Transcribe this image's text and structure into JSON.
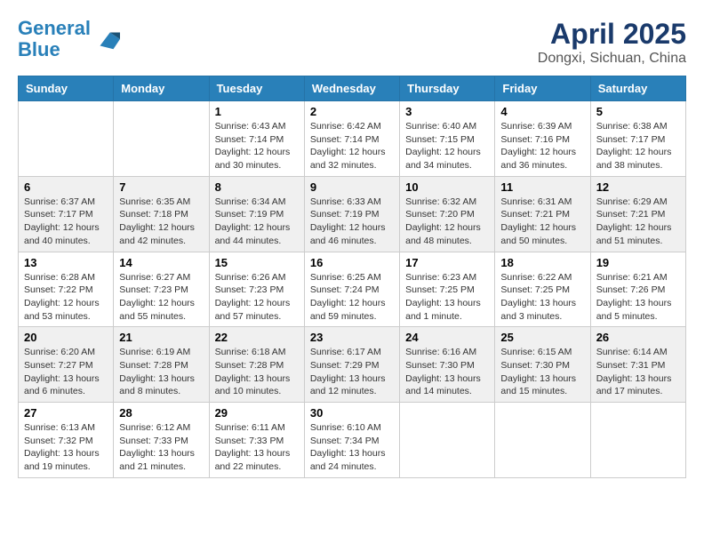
{
  "logo": {
    "line1": "General",
    "line2": "Blue"
  },
  "title": "April 2025",
  "location": "Dongxi, Sichuan, China",
  "headers": [
    "Sunday",
    "Monday",
    "Tuesday",
    "Wednesday",
    "Thursday",
    "Friday",
    "Saturday"
  ],
  "weeks": [
    [
      {
        "day": "",
        "info": ""
      },
      {
        "day": "",
        "info": ""
      },
      {
        "day": "1",
        "info": "Sunrise: 6:43 AM\nSunset: 7:14 PM\nDaylight: 12 hours and 30 minutes."
      },
      {
        "day": "2",
        "info": "Sunrise: 6:42 AM\nSunset: 7:14 PM\nDaylight: 12 hours and 32 minutes."
      },
      {
        "day": "3",
        "info": "Sunrise: 6:40 AM\nSunset: 7:15 PM\nDaylight: 12 hours and 34 minutes."
      },
      {
        "day": "4",
        "info": "Sunrise: 6:39 AM\nSunset: 7:16 PM\nDaylight: 12 hours and 36 minutes."
      },
      {
        "day": "5",
        "info": "Sunrise: 6:38 AM\nSunset: 7:17 PM\nDaylight: 12 hours and 38 minutes."
      }
    ],
    [
      {
        "day": "6",
        "info": "Sunrise: 6:37 AM\nSunset: 7:17 PM\nDaylight: 12 hours and 40 minutes."
      },
      {
        "day": "7",
        "info": "Sunrise: 6:35 AM\nSunset: 7:18 PM\nDaylight: 12 hours and 42 minutes."
      },
      {
        "day": "8",
        "info": "Sunrise: 6:34 AM\nSunset: 7:19 PM\nDaylight: 12 hours and 44 minutes."
      },
      {
        "day": "9",
        "info": "Sunrise: 6:33 AM\nSunset: 7:19 PM\nDaylight: 12 hours and 46 minutes."
      },
      {
        "day": "10",
        "info": "Sunrise: 6:32 AM\nSunset: 7:20 PM\nDaylight: 12 hours and 48 minutes."
      },
      {
        "day": "11",
        "info": "Sunrise: 6:31 AM\nSunset: 7:21 PM\nDaylight: 12 hours and 50 minutes."
      },
      {
        "day": "12",
        "info": "Sunrise: 6:29 AM\nSunset: 7:21 PM\nDaylight: 12 hours and 51 minutes."
      }
    ],
    [
      {
        "day": "13",
        "info": "Sunrise: 6:28 AM\nSunset: 7:22 PM\nDaylight: 12 hours and 53 minutes."
      },
      {
        "day": "14",
        "info": "Sunrise: 6:27 AM\nSunset: 7:23 PM\nDaylight: 12 hours and 55 minutes."
      },
      {
        "day": "15",
        "info": "Sunrise: 6:26 AM\nSunset: 7:23 PM\nDaylight: 12 hours and 57 minutes."
      },
      {
        "day": "16",
        "info": "Sunrise: 6:25 AM\nSunset: 7:24 PM\nDaylight: 12 hours and 59 minutes."
      },
      {
        "day": "17",
        "info": "Sunrise: 6:23 AM\nSunset: 7:25 PM\nDaylight: 13 hours and 1 minute."
      },
      {
        "day": "18",
        "info": "Sunrise: 6:22 AM\nSunset: 7:25 PM\nDaylight: 13 hours and 3 minutes."
      },
      {
        "day": "19",
        "info": "Sunrise: 6:21 AM\nSunset: 7:26 PM\nDaylight: 13 hours and 5 minutes."
      }
    ],
    [
      {
        "day": "20",
        "info": "Sunrise: 6:20 AM\nSunset: 7:27 PM\nDaylight: 13 hours and 6 minutes."
      },
      {
        "day": "21",
        "info": "Sunrise: 6:19 AM\nSunset: 7:28 PM\nDaylight: 13 hours and 8 minutes."
      },
      {
        "day": "22",
        "info": "Sunrise: 6:18 AM\nSunset: 7:28 PM\nDaylight: 13 hours and 10 minutes."
      },
      {
        "day": "23",
        "info": "Sunrise: 6:17 AM\nSunset: 7:29 PM\nDaylight: 13 hours and 12 minutes."
      },
      {
        "day": "24",
        "info": "Sunrise: 6:16 AM\nSunset: 7:30 PM\nDaylight: 13 hours and 14 minutes."
      },
      {
        "day": "25",
        "info": "Sunrise: 6:15 AM\nSunset: 7:30 PM\nDaylight: 13 hours and 15 minutes."
      },
      {
        "day": "26",
        "info": "Sunrise: 6:14 AM\nSunset: 7:31 PM\nDaylight: 13 hours and 17 minutes."
      }
    ],
    [
      {
        "day": "27",
        "info": "Sunrise: 6:13 AM\nSunset: 7:32 PM\nDaylight: 13 hours and 19 minutes."
      },
      {
        "day": "28",
        "info": "Sunrise: 6:12 AM\nSunset: 7:33 PM\nDaylight: 13 hours and 21 minutes."
      },
      {
        "day": "29",
        "info": "Sunrise: 6:11 AM\nSunset: 7:33 PM\nDaylight: 13 hours and 22 minutes."
      },
      {
        "day": "30",
        "info": "Sunrise: 6:10 AM\nSunset: 7:34 PM\nDaylight: 13 hours and 24 minutes."
      },
      {
        "day": "",
        "info": ""
      },
      {
        "day": "",
        "info": ""
      },
      {
        "day": "",
        "info": ""
      }
    ]
  ]
}
